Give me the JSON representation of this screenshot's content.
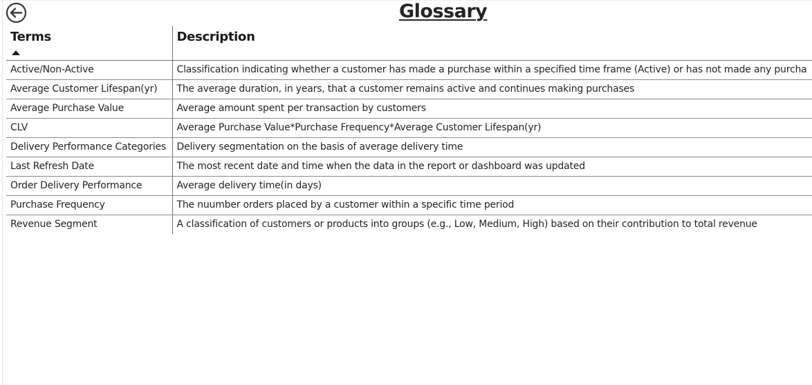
{
  "page": {
    "title": "Glossary"
  },
  "icons": {
    "back": "back-arrow-circle-icon"
  },
  "table": {
    "headers": {
      "term": "Terms",
      "description": "Description"
    },
    "sort": {
      "column": "Terms",
      "direction": "ascending"
    },
    "rows": [
      {
        "term": "Active/Non-Active",
        "description": "Classification indicating whether a customer has made a purchase within a specified time frame (Active) or has not made any purcha"
      },
      {
        "term": "Average Customer Lifespan(yr)",
        "description": "The average duration, in years, that a customer remains active and continues making purchases"
      },
      {
        "term": "Average Purchase Value",
        "description": "Average amount spent per transaction by customers"
      },
      {
        "term": "CLV",
        "description": "Average Purchase Value*Purchase Frequency*Average Customer Lifespan(yr)"
      },
      {
        "term": "Delivery Performance Categories",
        "description": "Delivery segmentation on the basis of average delivery time"
      },
      {
        "term": "Last Refresh Date",
        "description": "The most recent date and time when the data in the report or dashboard was updated"
      },
      {
        "term": "Order Delivery Performance",
        "description": "Average delivery time(in days)"
      },
      {
        "term": "Purchase Frequency",
        "description": "The nuumber orders placed by a customer within a specific time period"
      },
      {
        "term": "Revenue Segment",
        "description": "A classification of customers or products into groups (e.g., Low, Medium, High) based on their contribution to total revenue"
      }
    ]
  }
}
